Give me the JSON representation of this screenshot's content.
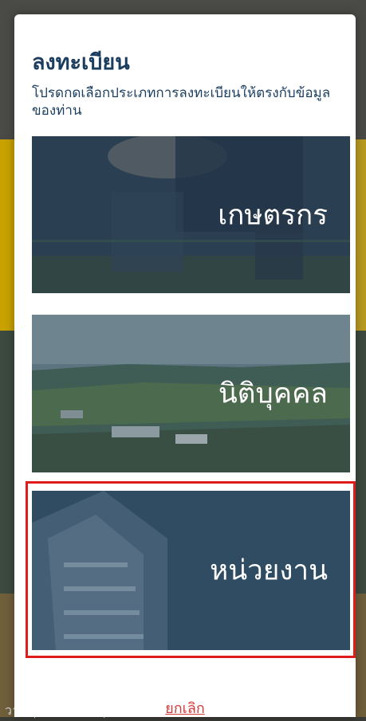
{
  "background": {
    "footer_text": "วามคุ้มครองส่วนบุคคล"
  },
  "modal": {
    "title": "ลงทะเบียน",
    "subtitle": "โปรดกดเลือกประเภทการลงทะเบียนให้ตรงกับข้อมูลของท่าน",
    "options": [
      {
        "label": "เกษตรกร"
      },
      {
        "label": "นิติบุคคล"
      },
      {
        "label": "หน่วยงาน"
      }
    ],
    "cancel_label": "ยกเลิก"
  },
  "colors": {
    "title": "#1b3e5f",
    "cancel": "#d23a3a",
    "selection_border": "#e01b1b"
  }
}
